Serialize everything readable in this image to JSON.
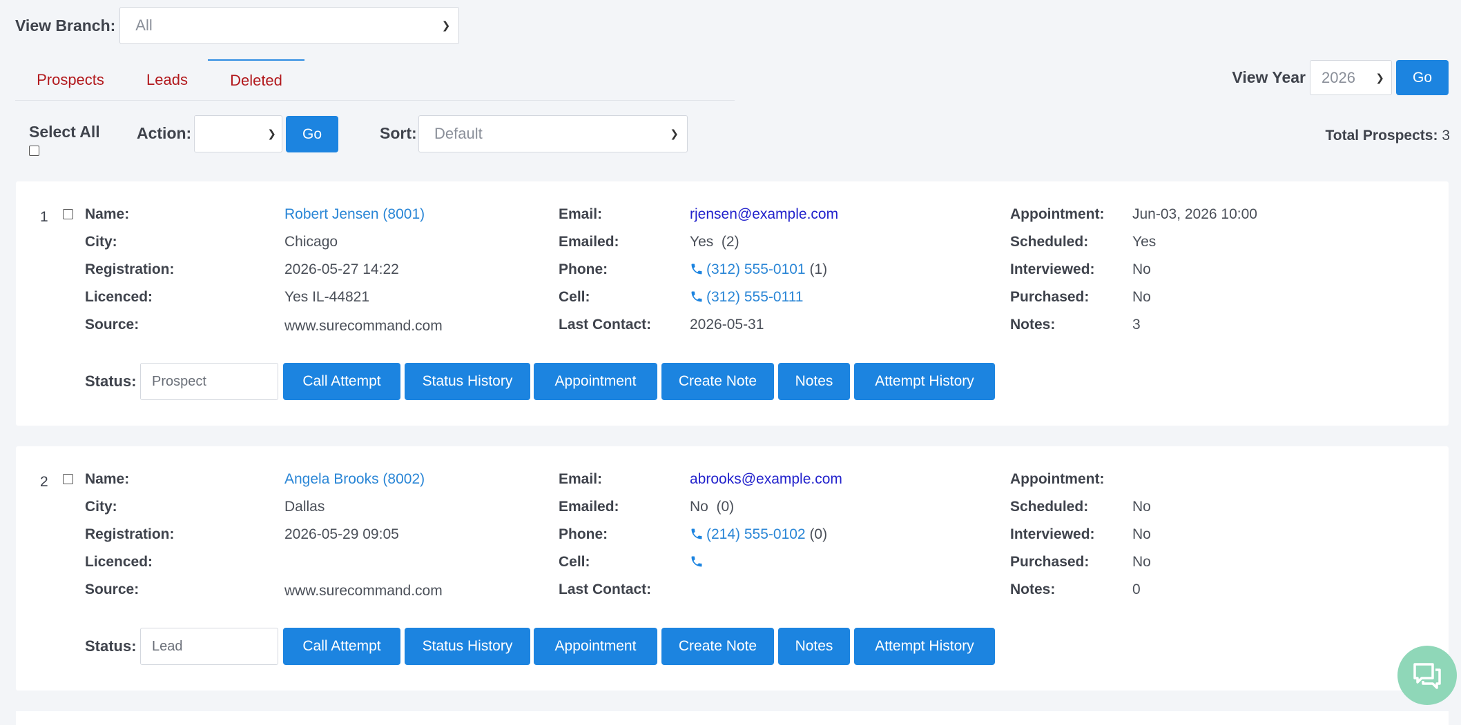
{
  "branch": {
    "label": "View Branch:",
    "selected": "All"
  },
  "tabs": [
    {
      "label": "Prospects",
      "active": false
    },
    {
      "label": "Leads",
      "active": false
    },
    {
      "label": "Deleted",
      "active": true
    }
  ],
  "year": {
    "label": "View Year",
    "selected": "2026",
    "go_label": "Go"
  },
  "toolbar": {
    "select_all_label": "Select All",
    "action_label": "Action:",
    "action_selected": "",
    "go_label": "Go",
    "sort_label": "Sort:",
    "sort_selected": "Default"
  },
  "total": {
    "label": "Total Prospects:",
    "value": "3"
  },
  "labels": {
    "name": "Name:",
    "city": "City:",
    "registration": "Registration:",
    "licenced": "Licenced:",
    "source": "Source:",
    "email": "Email:",
    "emailed": "Emailed:",
    "phone": "Phone:",
    "cell": "Cell:",
    "last_contact": "Last Contact:",
    "appointment": "Appointment:",
    "scheduled": "Scheduled:",
    "interviewed": "Interviewed:",
    "purchased": "Purchased:",
    "notes": "Notes:",
    "status": "Status:"
  },
  "buttons": {
    "call_attempt": "Call Attempt",
    "status_history": "Status History",
    "appointment": "Appointment",
    "create_note": "Create Note",
    "notes": "Notes",
    "attempt_history": "Attempt History"
  },
  "prospects": [
    {
      "index": "1",
      "name": "Robert Jensen (8001)",
      "city": "Chicago",
      "registration": "2026-05-27 14:22",
      "licenced": "Yes IL-44821",
      "source": "www.surecommand.com",
      "email": "rjensen@example.com",
      "emailed": "Yes  (2)",
      "phone": "(312) 555-0101",
      "phone_count": " (1)",
      "cell": "(312) 555-0111",
      "last_contact": "2026-05-31",
      "appointment": "Jun-03, 2026 10:00",
      "scheduled": "Yes",
      "interviewed": "No",
      "purchased": "No",
      "notes": "3",
      "status": "Prospect"
    },
    {
      "index": "2",
      "name": "Angela Brooks (8002)",
      "city": "Dallas",
      "registration": "2026-05-29 09:05",
      "licenced": "",
      "source": "www.surecommand.com",
      "email": "abrooks@example.com",
      "emailed": "No  (0)",
      "phone": "(214) 555-0102",
      "phone_count": " (0)",
      "cell": "",
      "last_contact": "",
      "appointment": "",
      "scheduled": "No",
      "interviewed": "No",
      "purchased": "No",
      "notes": "0",
      "status": "Lead"
    }
  ],
  "colors": {
    "accent": "#1c84e0",
    "tab_text": "#b2191d",
    "link": "#2a86d6",
    "chat": "#8fd7b8"
  },
  "icons": {
    "phone": "phone-icon",
    "chat": "chat-icon",
    "dropdown": "chevron-down-icon"
  }
}
